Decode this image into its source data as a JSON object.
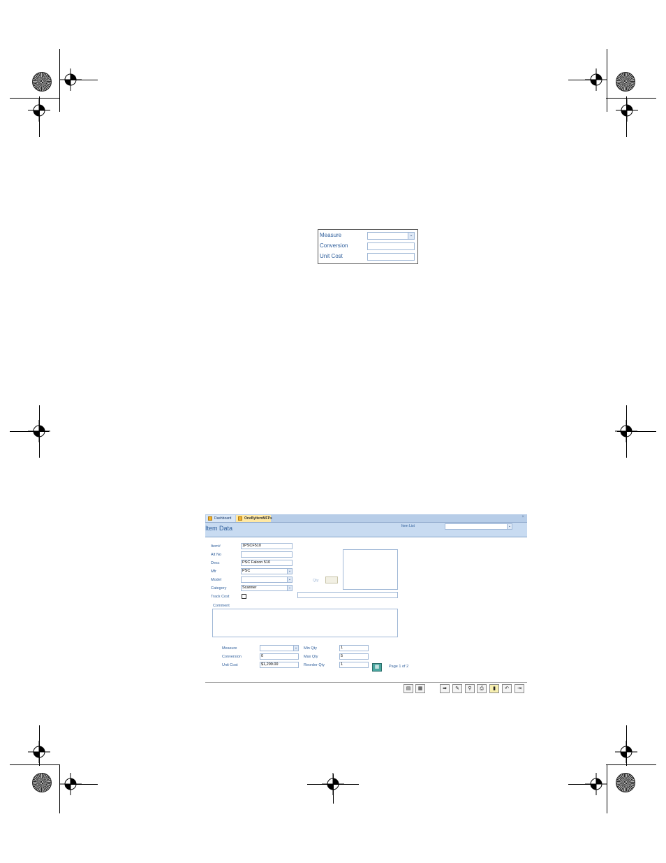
{
  "callout": {
    "fields": [
      {
        "label": "Measure",
        "value": "",
        "type": "dropdown"
      },
      {
        "label": "Conversion",
        "value": "",
        "type": "text"
      },
      {
        "label": "Unit Cost",
        "value": "",
        "type": "text"
      }
    ]
  },
  "app": {
    "tabs": [
      {
        "label": "Dashboard",
        "active": false
      },
      {
        "label": "OneByItemMFPs",
        "active": true
      }
    ],
    "close_glyph": "×",
    "header": {
      "title": "Item Data",
      "item_list_label": "Item List",
      "item_list_value": ""
    },
    "fields": {
      "item_no": {
        "label": "Item#",
        "value": "1PSCF510"
      },
      "alt_no": {
        "label": "Alt No",
        "value": ""
      },
      "desc": {
        "label": "Desc",
        "value": "PSC Falcon 510"
      },
      "mfr": {
        "label": "Mfr",
        "value": "PSC"
      },
      "model": {
        "label": "Model",
        "value": ""
      },
      "category": {
        "label": "Category",
        "value": "Scanner"
      },
      "track_cost": {
        "label": "Track Cost",
        "checked": false
      },
      "qty": {
        "label": "Qty",
        "value": ""
      },
      "comment": {
        "label": "Comment",
        "value": ""
      }
    },
    "lower": {
      "measure": {
        "label": "Measure",
        "value": ""
      },
      "conversion": {
        "label": "Conversion",
        "value": "0"
      },
      "unit_cost": {
        "label": "Unit Cost",
        "value": "$1,299.00"
      },
      "min_qty": {
        "label": "Min Qty",
        "value": "1"
      },
      "max_qty": {
        "label": "Max Qty",
        "value": "5"
      },
      "reorder_qty": {
        "label": "Reorder Qty",
        "value": "1"
      },
      "page_indicator": "Page 1 of 2"
    },
    "toolbar": {
      "buttons": [
        {
          "name": "new-record-icon",
          "glyph": "▤"
        },
        {
          "name": "calendar-icon",
          "glyph": "▦"
        },
        {
          "name": "next-record-icon",
          "glyph": "➡"
        },
        {
          "name": "edit-record-icon",
          "glyph": "✎"
        },
        {
          "name": "search-icon",
          "glyph": "⚲"
        },
        {
          "name": "print-icon",
          "glyph": "⎙"
        },
        {
          "name": "delete-icon",
          "glyph": "▮"
        },
        {
          "name": "undo-icon",
          "glyph": "↶"
        },
        {
          "name": "exit-icon",
          "glyph": "⇥"
        }
      ]
    }
  },
  "colors": {
    "accent": "#2f5f9c",
    "header_bg": "#c8dbf1",
    "active_tab": "#ffe8a3"
  }
}
